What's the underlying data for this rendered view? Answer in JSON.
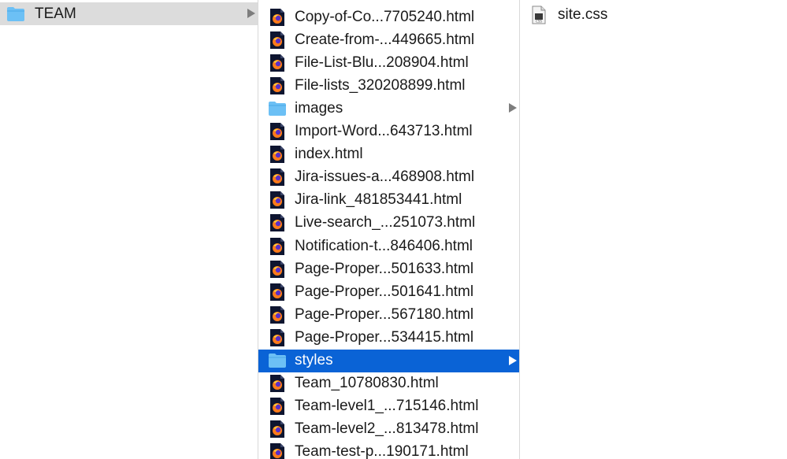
{
  "column1": {
    "items": [
      {
        "label": "TEAM",
        "icon": "folder-icon",
        "selected": "inactive",
        "expandable": true
      }
    ]
  },
  "column2": {
    "items": [
      {
        "label": "Copy-of-Co...7705240.html",
        "icon": "firefox-html-file-icon"
      },
      {
        "label": "Create-from-...449665.html",
        "icon": "firefox-html-file-icon"
      },
      {
        "label": "File-List-Blu...208904.html",
        "icon": "firefox-html-file-icon"
      },
      {
        "label": "File-lists_320208899.html",
        "icon": "firefox-html-file-icon"
      },
      {
        "label": "images",
        "icon": "folder-icon",
        "expandable": true
      },
      {
        "label": "Import-Word...643713.html",
        "icon": "firefox-html-file-icon"
      },
      {
        "label": "index.html",
        "icon": "firefox-html-file-icon"
      },
      {
        "label": "Jira-issues-a...468908.html",
        "icon": "firefox-html-file-icon"
      },
      {
        "label": "Jira-link_481853441.html",
        "icon": "firefox-html-file-icon"
      },
      {
        "label": "Live-search_...251073.html",
        "icon": "firefox-html-file-icon"
      },
      {
        "label": "Notification-t...846406.html",
        "icon": "firefox-html-file-icon"
      },
      {
        "label": "Page-Proper...501633.html",
        "icon": "firefox-html-file-icon"
      },
      {
        "label": "Page-Proper...501641.html",
        "icon": "firefox-html-file-icon"
      },
      {
        "label": "Page-Proper...567180.html",
        "icon": "firefox-html-file-icon"
      },
      {
        "label": "Page-Proper...534415.html",
        "icon": "firefox-html-file-icon"
      },
      {
        "label": "styles",
        "icon": "folder-icon",
        "expandable": true,
        "selected": "active"
      },
      {
        "label": "Team_10780830.html",
        "icon": "firefox-html-file-icon"
      },
      {
        "label": "Team-level1_...715146.html",
        "icon": "firefox-html-file-icon"
      },
      {
        "label": "Team-level2_...813478.html",
        "icon": "firefox-html-file-icon"
      },
      {
        "label": "Team-test-p...190171.html",
        "icon": "firefox-html-file-icon"
      }
    ]
  },
  "column3": {
    "items": [
      {
        "label": "site.css",
        "icon": "css-file-icon"
      }
    ]
  },
  "colors": {
    "selection_active": "#0a63d6",
    "selection_inactive": "#dcdcdc",
    "folder": "#6cc0f5",
    "divider": "#d9d9d9"
  }
}
